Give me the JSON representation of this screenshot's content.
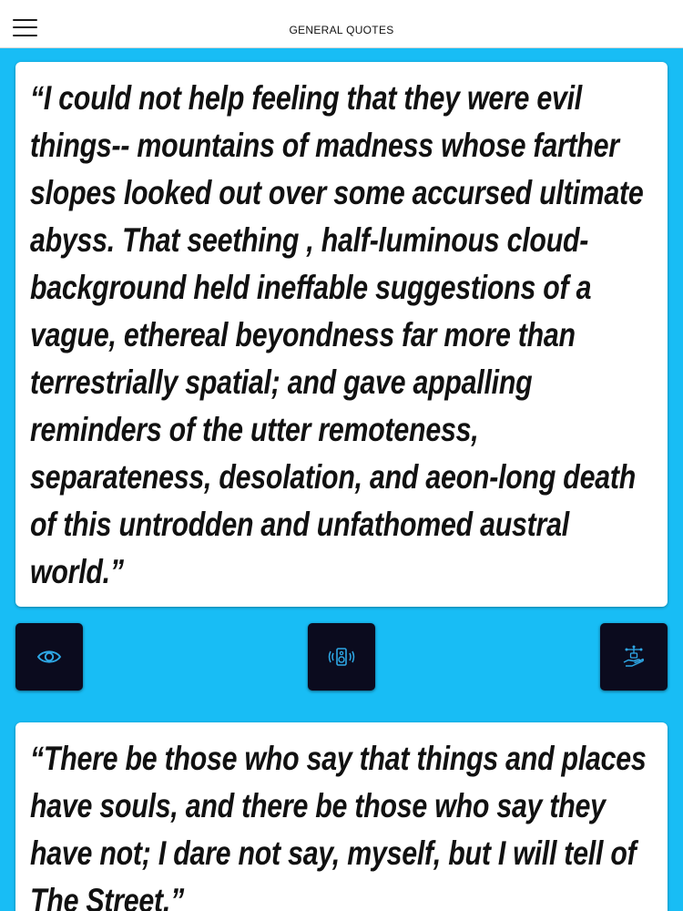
{
  "header": {
    "title": "GENERAL QUOTES"
  },
  "quotes": [
    {
      "text": "“I could not help feeling that they were evil things-- mountains of madness whose farther slopes looked out over some accursed ultimate abyss. That seething , half-luminous cloud-background held ineffable suggestions of a vague, ethereal beyondness far more than terrestrially spatial; and gave appalling reminders of the utter remoteness, separateness, desolation, and aeon-long death of this untrodden and unfathomed austral world.”"
    },
    {
      "text": "“There be those who say that things and places have souls, and there be those who say they have not; I dare not say, myself, but I will tell of The Street.”"
    }
  ],
  "actions": [
    {
      "icon": "eye-icon"
    },
    {
      "icon": "speaker-icon"
    },
    {
      "icon": "hand-share-icon"
    }
  ],
  "colors": {
    "background": "#18bdf5",
    "button_bg": "#0b0b1e",
    "icon_accent": "#2ea8e6"
  }
}
